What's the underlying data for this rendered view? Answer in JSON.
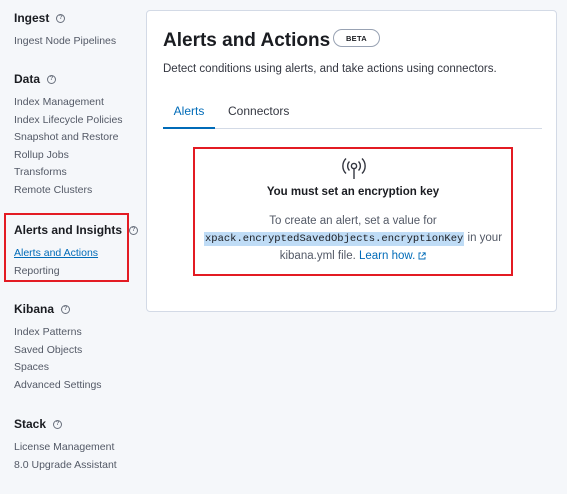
{
  "sidebar": {
    "ingest": {
      "title": "Ingest",
      "items": [
        "Ingest Node Pipelines"
      ]
    },
    "data": {
      "title": "Data",
      "items": [
        "Index Management",
        "Index Lifecycle Policies",
        "Snapshot and Restore",
        "Rollup Jobs",
        "Transforms",
        "Remote Clusters"
      ]
    },
    "alerts": {
      "title": "Alerts and Insights",
      "items": [
        "Alerts and Actions",
        "Reporting"
      ]
    },
    "kibana": {
      "title": "Kibana",
      "items": [
        "Index Patterns",
        "Saved Objects",
        "Spaces",
        "Advanced Settings"
      ]
    },
    "stack": {
      "title": "Stack",
      "items": [
        "License Management",
        "8.0 Upgrade Assistant"
      ]
    }
  },
  "main": {
    "title": "Alerts and Actions",
    "badge": "BETA",
    "description": "Detect conditions using alerts, and take actions using connectors.",
    "tabs": [
      "Alerts",
      "Connectors"
    ],
    "empty_state": {
      "icon": "antenna-icon",
      "title": "You must set an encryption key",
      "body_before": "To create an alert, set a value for",
      "code": "xpack.encryptedSavedObjects.encryptionKey",
      "body_after": " in your kibana.yml file.",
      "link": "Learn how."
    }
  },
  "colors": {
    "accent": "#006bb8",
    "highlight": "#e31b23",
    "code_bg": "#bfdcf6"
  }
}
